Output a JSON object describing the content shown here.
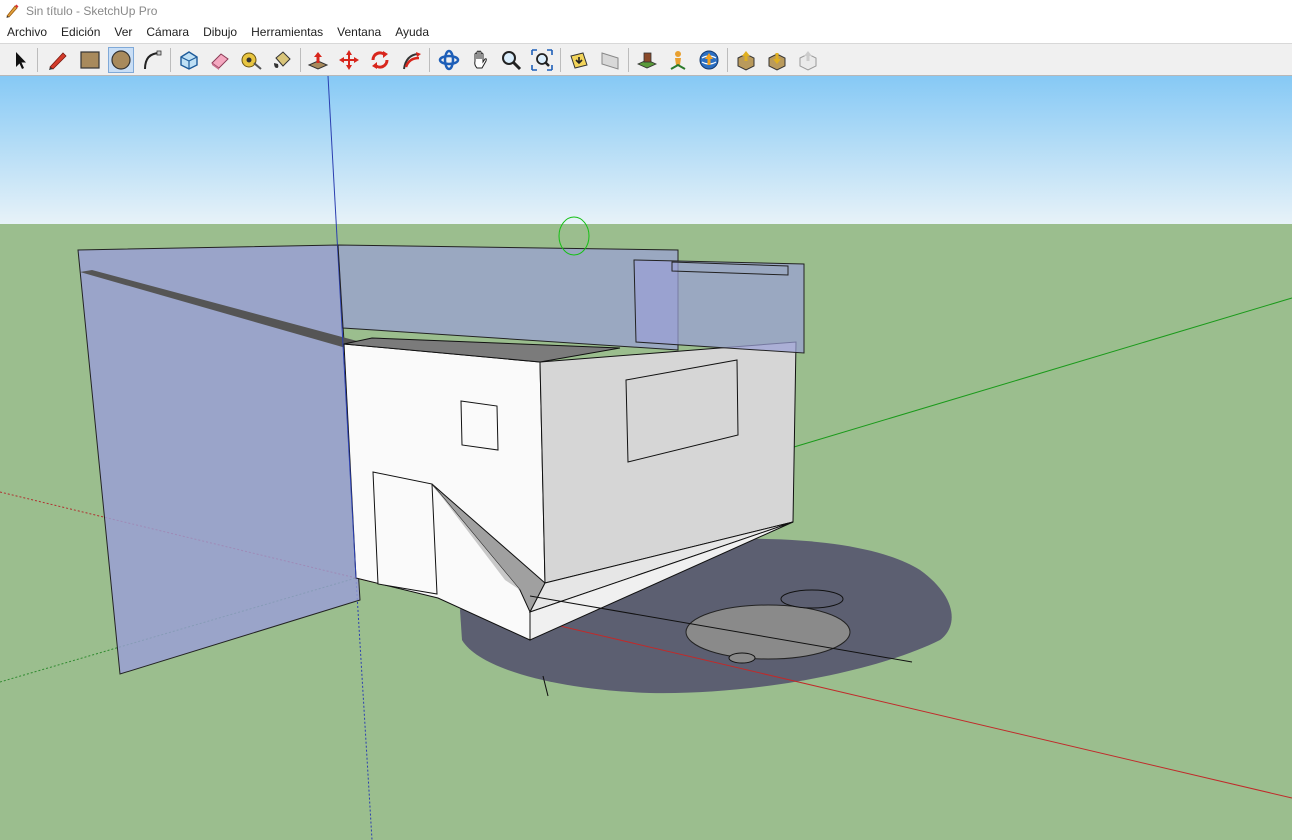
{
  "window": {
    "title": "Sin título - SketchUp Pro",
    "app_icon": "pencil-icon"
  },
  "menubar": {
    "items": [
      "Archivo",
      "Edición",
      "Ver",
      "Cámara",
      "Dibujo",
      "Herramientas",
      "Ventana",
      "Ayuda"
    ]
  },
  "toolbar": {
    "tools": [
      "select-tool",
      "line-tool",
      "rectangle-tool",
      "circle-tool",
      "arc-tool",
      "make-component-tool",
      "eraser-tool",
      "tape-measure-tool",
      "paint-bucket-tool",
      "push-pull-tool",
      "move-tool",
      "rotate-tool",
      "follow-me-tool",
      "orbit-tool",
      "pan-tool",
      "zoom-tool",
      "zoom-extents-tool",
      "previous-view-tool",
      "next-view-tool",
      "add-location-tool",
      "position-camera-tool",
      "get-models-tool",
      "share-model-tool",
      "get-components-tool",
      "share-component-tool"
    ],
    "active_tool": "circle-tool"
  },
  "viewport": {
    "sky_top_color": "#86c9f5",
    "sky_bottom_color": "#e7f2f8",
    "ground_color": "#9bbe8e",
    "shadow_color": "#5c5f71",
    "section_plane_color": "#9a9fd6"
  }
}
